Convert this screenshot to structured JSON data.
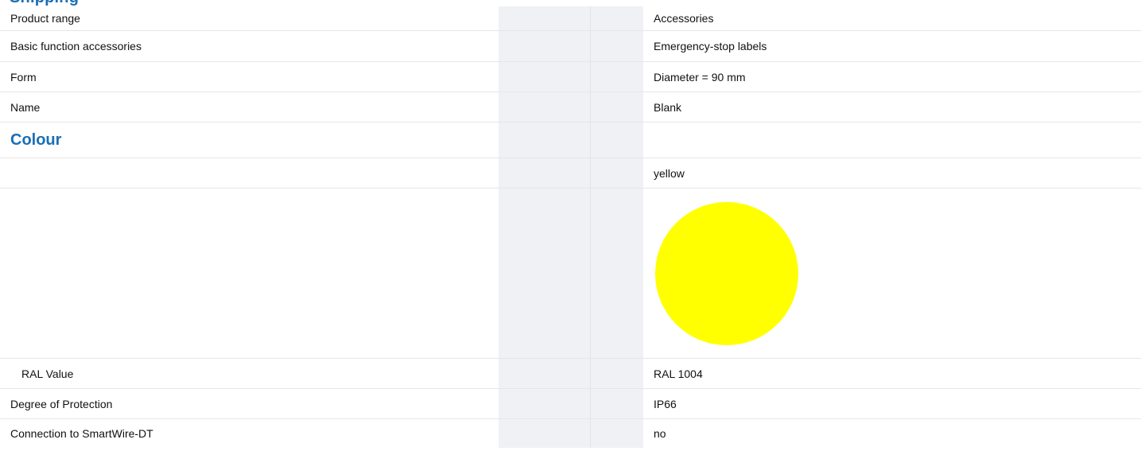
{
  "header": {
    "title": "Shipping"
  },
  "rows": [
    {
      "label": "Product range",
      "value": "Accessories"
    },
    {
      "label": "Basic function accessories",
      "value": "Emergency-stop labels"
    },
    {
      "label": "Form",
      "value": "Diameter = 90 mm"
    },
    {
      "label": "Name",
      "value": "Blank"
    }
  ],
  "colour_section": {
    "title": "Colour",
    "colour_name": "yellow",
    "swatch_color": "#ffff00",
    "ral_label": "RAL Value",
    "ral_value": "RAL 1004"
  },
  "bottom_rows": [
    {
      "label": "Degree of Protection",
      "value": "IP66"
    },
    {
      "label": "Connection to SmartWire-DT",
      "value": "no"
    }
  ]
}
